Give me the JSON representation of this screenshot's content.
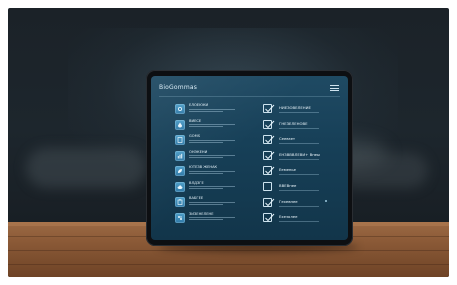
{
  "app": {
    "title": "BioGommas"
  },
  "left_items": [
    {
      "label": "ЕЛОЕЮКИ",
      "icon": "gear-icon"
    },
    {
      "label": "ВИЕСЕ",
      "icon": "drop-icon"
    },
    {
      "label": "GOMS",
      "icon": "document-icon"
    },
    {
      "label": "ОНЭКЕНИ",
      "icon": "chart-icon"
    },
    {
      "label": "ЮТЕЗВ ЖЕНАК",
      "icon": "leaf-icon"
    },
    {
      "label": "ВЛДЗГЕ",
      "icon": "cloud-icon"
    },
    {
      "label": "ВАБГЕЕ",
      "icon": "clipboard-icon"
    },
    {
      "label": "ЗИЗЕНЕЛЕНЕ",
      "icon": "settings-icon"
    }
  ],
  "checklist": [
    {
      "label": "НИЕЗОВЕЛЕНИЕ",
      "checked": true
    },
    {
      "label": "ГНЕЗЕЛЕНОВЕ",
      "checked": true
    },
    {
      "label": "Сеевзет",
      "checked": true
    },
    {
      "label": "ЕНЗВВВЛЕВИ+ Внеы",
      "checked": true
    },
    {
      "label": "Ееменье",
      "checked": true
    },
    {
      "label": "ВВЕВнее",
      "checked": false
    },
    {
      "label": "Гехевнее",
      "checked": true
    },
    {
      "label": "Ехезолее",
      "checked": true
    }
  ]
}
